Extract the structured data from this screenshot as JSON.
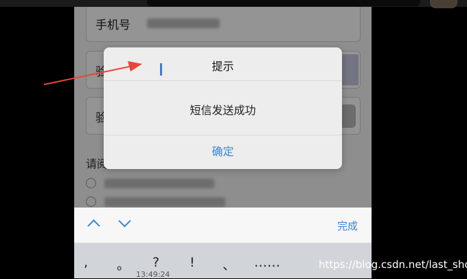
{
  "form": {
    "phone_label": "手机号",
    "captcha_label": "验",
    "sms_code_label": "验",
    "agree_label": "请阅"
  },
  "dialog": {
    "title": "提示",
    "message": "短信发送成功",
    "ok_label": "确定"
  },
  "keyboard_toolbar": {
    "done_label": "完成",
    "icons": [
      "chevron-up-icon",
      "chevron-down-icon"
    ]
  },
  "keyboard": {
    "keys": [
      ",",
      "。",
      "?",
      "!",
      "、",
      "……"
    ]
  },
  "status": {
    "time": "13:49:24"
  },
  "watermark": "https://blog.csdn.net/last_sho",
  "colors": {
    "accent": "#3a85d6",
    "arrow": "#e8453c"
  }
}
